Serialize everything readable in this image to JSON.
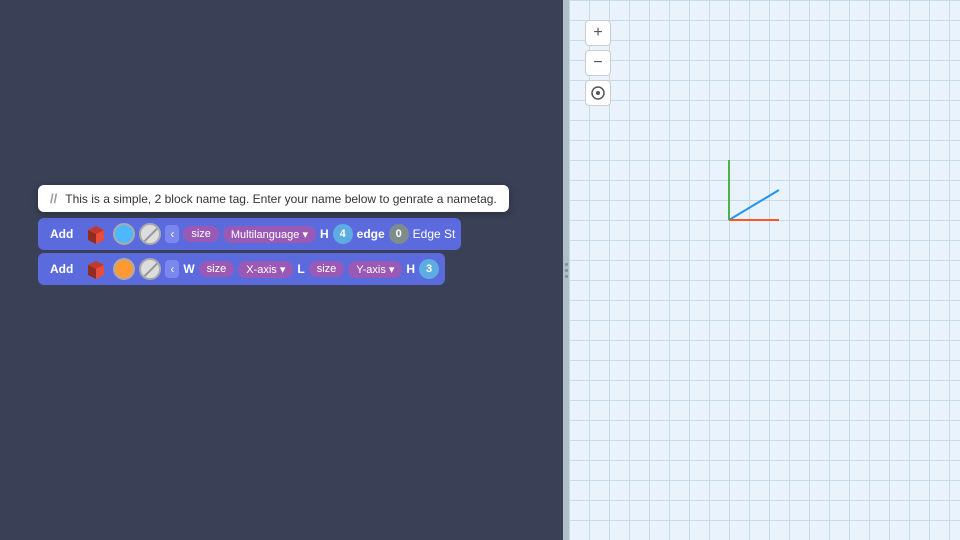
{
  "tooltip": {
    "comment": "//",
    "text": "This is a simple, 2 block name tag. Enter your name below to genrate a nametag."
  },
  "row1": {
    "add_label": "Add",
    "label_h": "H",
    "num_4": "4",
    "label_edge": "edge",
    "num_0": "0",
    "edge_suffix": "Edge St",
    "multilanguage_label": "Multilanguage",
    "size_label": "size"
  },
  "row2": {
    "add_label": "Add",
    "label_w": "W",
    "size_label1": "size",
    "xaxis_label": "X-axis",
    "label_l": "L",
    "size_label2": "size",
    "yaxis_label": "Y-axis",
    "label_h": "H",
    "num_3": "3"
  },
  "canvas": {
    "zoom_in": "+",
    "zoom_out": "−",
    "compass": "⊙"
  }
}
